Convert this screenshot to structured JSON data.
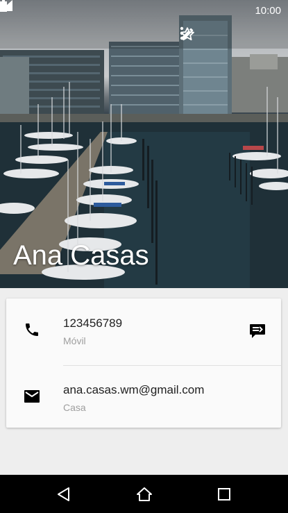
{
  "status_bar": {
    "time": "10:00",
    "signal_icon": "signal-icon",
    "battery_icon": "battery-icon"
  },
  "toolbar": {
    "icons": [
      "star-outline-icon",
      "edit-pencil-icon",
      "more-vert-icon"
    ]
  },
  "contact": {
    "name": "Ana Casas",
    "phone": {
      "number": "123456789",
      "type": "Móvil",
      "icon": "phone-icon",
      "action_icon": "message-icon"
    },
    "email": {
      "address": "ana.casas.wm@gmail.com",
      "type": "Casa",
      "icon": "email-icon"
    }
  },
  "nav_bar": {
    "icons": [
      "back-icon",
      "home-icon",
      "recents-icon"
    ]
  },
  "colors": {
    "card_bg": "#fafafa",
    "page_bg": "#eeeeee",
    "nav_bg": "#000000",
    "secondary_text": "#9e9e9e"
  }
}
